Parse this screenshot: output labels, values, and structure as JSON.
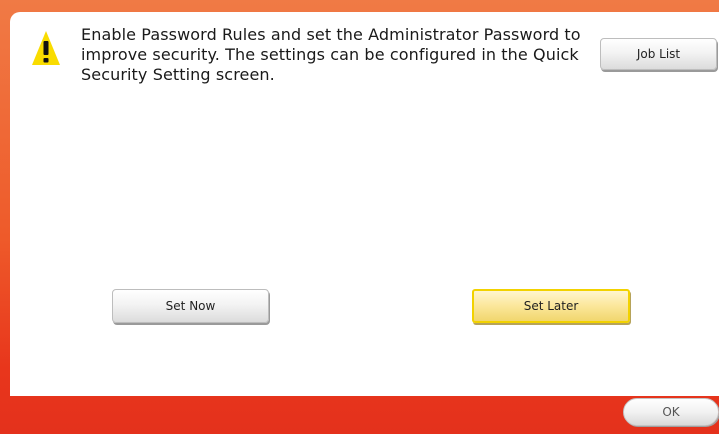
{
  "dialog": {
    "message": "Enable Password Rules and set the Administrator Password to improve security. The settings can be configured in the Quick Security Setting screen.",
    "icon": "warning-icon"
  },
  "buttons": {
    "job_list": "Job List",
    "set_now": "Set Now",
    "set_later": "Set Later",
    "ok": "OK"
  },
  "colors": {
    "frame_top": "#f07a45",
    "frame_bottom": "#e4311c",
    "selected_fill": "#fbe79a",
    "selected_border": "#f2d200"
  }
}
